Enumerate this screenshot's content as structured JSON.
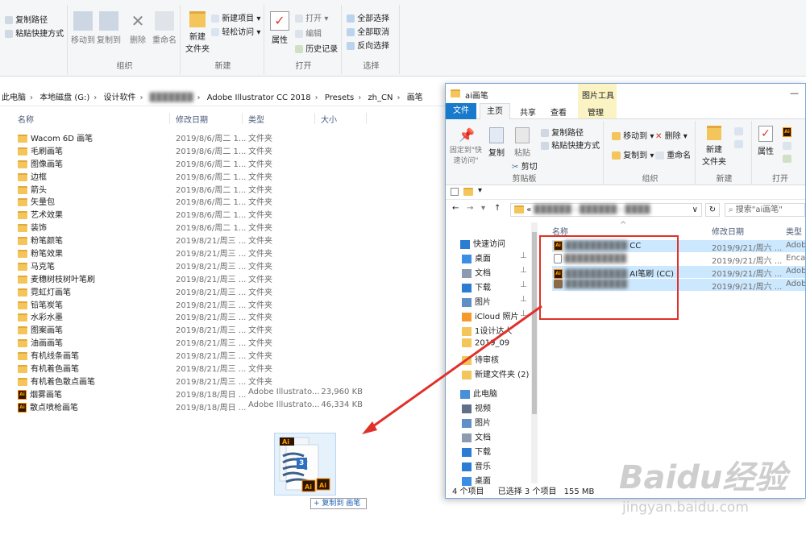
{
  "left_window": {
    "ribbon": {
      "copy_path": "复制路径",
      "paste_shortcut": "粘贴快捷方式",
      "move_to": "移动到",
      "copy_to": "复制到",
      "delete": "删除",
      "rename": "重命名",
      "organize_label": "组织",
      "new_folder": "新建\n文件夹",
      "new_item": "新建项目",
      "easy_access": "轻松访问",
      "new_label": "新建",
      "properties": "属性",
      "open": "打开",
      "edit": "编辑",
      "history": "历史记录",
      "open_label": "打开",
      "select_all": "全部选择",
      "select_none": "全部取消",
      "invert_selection": "反向选择",
      "select_label": "选择"
    },
    "breadcrumb": [
      "此电脑",
      "本地磁盘 (G:)",
      "设计软件",
      "Adobe Illustrator CC 2018",
      "Presets",
      "zh_CN",
      "画笔"
    ],
    "columns": {
      "name": "名称",
      "date": "修改日期",
      "type": "类型",
      "size": "大小"
    },
    "rows": [
      {
        "name": "Wacom 6D 画笔",
        "date": "2019/8/6/周二 1...",
        "type": "文件夹",
        "size": "",
        "kind": "folder"
      },
      {
        "name": "毛刷画笔",
        "date": "2019/8/6/周二 1...",
        "type": "文件夹",
        "size": "",
        "kind": "folder"
      },
      {
        "name": "图像画笔",
        "date": "2019/8/6/周二 1...",
        "type": "文件夹",
        "size": "",
        "kind": "folder"
      },
      {
        "name": "边框",
        "date": "2019/8/6/周二 1...",
        "type": "文件夹",
        "size": "",
        "kind": "folder"
      },
      {
        "name": "箭头",
        "date": "2019/8/6/周二 1...",
        "type": "文件夹",
        "size": "",
        "kind": "folder"
      },
      {
        "name": "矢量包",
        "date": "2019/8/6/周二 1...",
        "type": "文件夹",
        "size": "",
        "kind": "folder"
      },
      {
        "name": "艺术效果",
        "date": "2019/8/6/周二 1...",
        "type": "文件夹",
        "size": "",
        "kind": "folder"
      },
      {
        "name": "装饰",
        "date": "2019/8/6/周二 1...",
        "type": "文件夹",
        "size": "",
        "kind": "folder"
      },
      {
        "name": "粉笔颜笔",
        "date": "2019/8/21/周三 ...",
        "type": "文件夹",
        "size": "",
        "kind": "folder"
      },
      {
        "name": "粉笔效果",
        "date": "2019/8/21/周三 ...",
        "type": "文件夹",
        "size": "",
        "kind": "folder"
      },
      {
        "name": "马克笔",
        "date": "2019/8/21/周三 ...",
        "type": "文件夹",
        "size": "",
        "kind": "folder"
      },
      {
        "name": "麦穗树枝树叶笔刷",
        "date": "2019/8/21/周三 ...",
        "type": "文件夹",
        "size": "",
        "kind": "folder"
      },
      {
        "name": "霓虹灯画笔",
        "date": "2019/8/21/周三 ...",
        "type": "文件夹",
        "size": "",
        "kind": "folder"
      },
      {
        "name": "铅笔炭笔",
        "date": "2019/8/21/周三 ...",
        "type": "文件夹",
        "size": "",
        "kind": "folder"
      },
      {
        "name": "水彩水墨",
        "date": "2019/8/21/周三 ...",
        "type": "文件夹",
        "size": "",
        "kind": "folder"
      },
      {
        "name": "图案画笔",
        "date": "2019/8/21/周三 ...",
        "type": "文件夹",
        "size": "",
        "kind": "folder"
      },
      {
        "name": "油画画笔",
        "date": "2019/8/21/周三 ...",
        "type": "文件夹",
        "size": "",
        "kind": "folder"
      },
      {
        "name": "有机线条画笔",
        "date": "2019/8/21/周三 ...",
        "type": "文件夹",
        "size": "",
        "kind": "folder"
      },
      {
        "name": "有机着色画笔",
        "date": "2019/8/21/周三 ...",
        "type": "文件夹",
        "size": "",
        "kind": "folder"
      },
      {
        "name": "有机着色散点画笔",
        "date": "2019/8/21/周三 ...",
        "type": "文件夹",
        "size": "",
        "kind": "folder"
      },
      {
        "name": "烟雾画笔",
        "date": "2019/8/18/周日 ...",
        "type": "Adobe Illustrato...",
        "size": "23,960 KB",
        "kind": "ai"
      },
      {
        "name": "散点喷枪画笔",
        "date": "2019/8/18/周日 ...",
        "type": "Adobe Illustrato...",
        "size": "46,334 KB",
        "kind": "ai"
      }
    ],
    "drag": {
      "badge_text": "+ 复制到 画笔",
      "count": "3"
    }
  },
  "right_window": {
    "title": "ai画笔",
    "tools_tab": "图片工具",
    "tabs": {
      "file": "文件",
      "home": "主页",
      "share": "共享",
      "view": "查看",
      "manage": "管理"
    },
    "ribbon": {
      "pin": "固定到\"快\n速访问\"",
      "copy": "复制",
      "paste": "粘贴",
      "copy_path": "复制路径",
      "paste_shortcut": "粘贴快捷方式",
      "cut": "剪切",
      "clipboard_label": "剪贴板",
      "move_to": "移动到",
      "copy_to": "复制到",
      "delete": "删除",
      "rename": "重命名",
      "organize_label": "组织",
      "new_folder": "新建\n文件夹",
      "new_label": "新建",
      "properties": "属性",
      "open_label": "打开"
    },
    "address_prefix": "«",
    "search_placeholder": "搜索\"ai画笔\"",
    "columns": {
      "name": "名称",
      "date": "修改日期",
      "type": "类型"
    },
    "nav": [
      {
        "label": "快速访问",
        "icon": "star-icon",
        "color": "#2b7cd3"
      },
      {
        "label": "桌面",
        "icon": "desktop-icon",
        "color": "#3a8ee6"
      },
      {
        "label": "文档",
        "icon": "document-icon",
        "color": "#8c9bb0"
      },
      {
        "label": "下载",
        "icon": "download-icon",
        "color": "#2b7cd3"
      },
      {
        "label": "图片",
        "icon": "pictures-icon",
        "color": "#5f8fc4"
      },
      {
        "label": "iCloud 照片",
        "icon": "icloud-photos-icon",
        "color": "#f59a2a"
      },
      {
        "label": "1设计达人",
        "icon": "folder-icon",
        "color": "#f4c55a"
      },
      {
        "label": "2019_09",
        "icon": "folder-icon",
        "color": "#f4c55a"
      },
      {
        "label": "待审核",
        "icon": "folder-icon",
        "color": "#f4c55a"
      },
      {
        "label": "新建文件夹 (2)",
        "icon": "folder-icon",
        "color": "#f4c55a"
      },
      {
        "label": "此电脑",
        "icon": "computer-icon",
        "color": "#4a90d9"
      },
      {
        "label": "视频",
        "icon": "videos-icon",
        "color": "#5f6f86"
      },
      {
        "label": "图片",
        "icon": "pictures-icon",
        "color": "#5f8fc4"
      },
      {
        "label": "文档",
        "icon": "document-icon",
        "color": "#8c9bb0"
      },
      {
        "label": "下载",
        "icon": "download-icon",
        "color": "#2b7cd3"
      },
      {
        "label": "音乐",
        "icon": "music-icon",
        "color": "#2b7cd3"
      },
      {
        "label": "桌面",
        "icon": "desktop-icon",
        "color": "#3a8ee6"
      }
    ],
    "rows": [
      {
        "name": "CC",
        "date": "2019/9/21/周六 ...",
        "type": "Adobe",
        "selected": true,
        "kind": "ai"
      },
      {
        "name": "",
        "date": "2019/9/21/周六 ...",
        "type": "Encap",
        "selected": false,
        "kind": "eps"
      },
      {
        "name": "AI笔刷 (CC)",
        "date": "2019/9/21/周六 ...",
        "type": "Adobe",
        "selected": true,
        "kind": "ai"
      },
      {
        "name": "",
        "date": "2019/9/21/周六 ...",
        "type": "Adobe",
        "selected": true,
        "kind": "img"
      }
    ],
    "status": {
      "items": "4 个项目",
      "selected": "已选择 3 个项目",
      "size": "155 MB"
    }
  },
  "watermark": {
    "brand": "Baidu经验",
    "url": "jingyan.baidu.com"
  },
  "colors": {
    "accent": "#1979ca",
    "selection": "#cce8ff",
    "annotation": "#e0302a"
  }
}
